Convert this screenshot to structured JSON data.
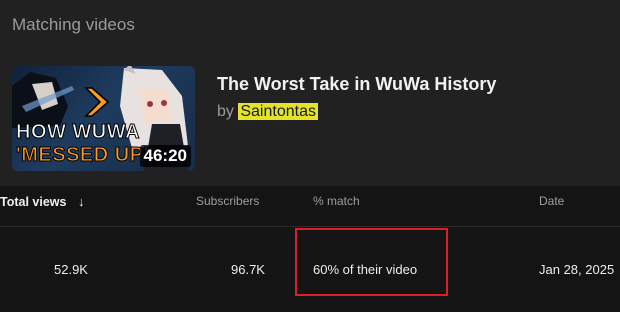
{
  "section": {
    "title": "Matching videos"
  },
  "video": {
    "thumbnail_text_line1": "HOW WUWA",
    "thumbnail_text_line2": "'MESSED UP'",
    "duration": "46:20",
    "title": "The Worst Take in WuWa History",
    "by_prefix": "by",
    "channel": "Saintontas"
  },
  "table": {
    "headers": [
      "Total views",
      "Subscribers",
      "% match",
      "Date"
    ],
    "sort": "descending",
    "rows": [
      [
        "52.9K",
        "96.7K",
        "60% of their video",
        "Jan 28, 2025"
      ]
    ]
  },
  "colors": {
    "background": "#141414",
    "card": "#212121",
    "channel_highlight": "#e3e32e",
    "annotation_box": "#d8202a"
  }
}
